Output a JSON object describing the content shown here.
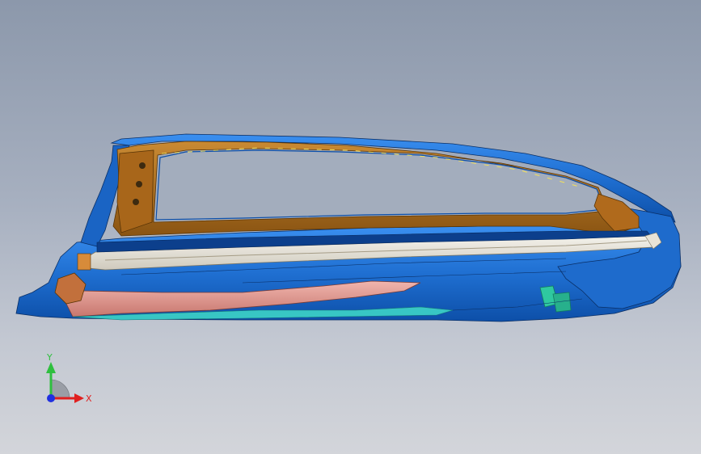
{
  "viewport": {
    "background_top": "#8c98ab",
    "background_bottom": "#d3d5da"
  },
  "model": {
    "icon": "car-body-side-panel-model",
    "colors": {
      "outer_panel": "#1f6fd1",
      "outer_panel_dark": "#0d4fa8",
      "inner_frame": "#b8741f",
      "inner_frame_dark": "#8a5412",
      "sill_reinforcement": "#e6e2d8",
      "lower_member": "#e59a92",
      "cyan_member": "#38c6c4",
      "green_bracket": "#2fc8a0"
    }
  },
  "triad": {
    "icon": "coordinate-axes-triad-icon",
    "y_label": "Y",
    "x_label": "X",
    "y_color": "#2fbf3f",
    "x_color": "#e02020",
    "z_color": "#2030e0"
  }
}
